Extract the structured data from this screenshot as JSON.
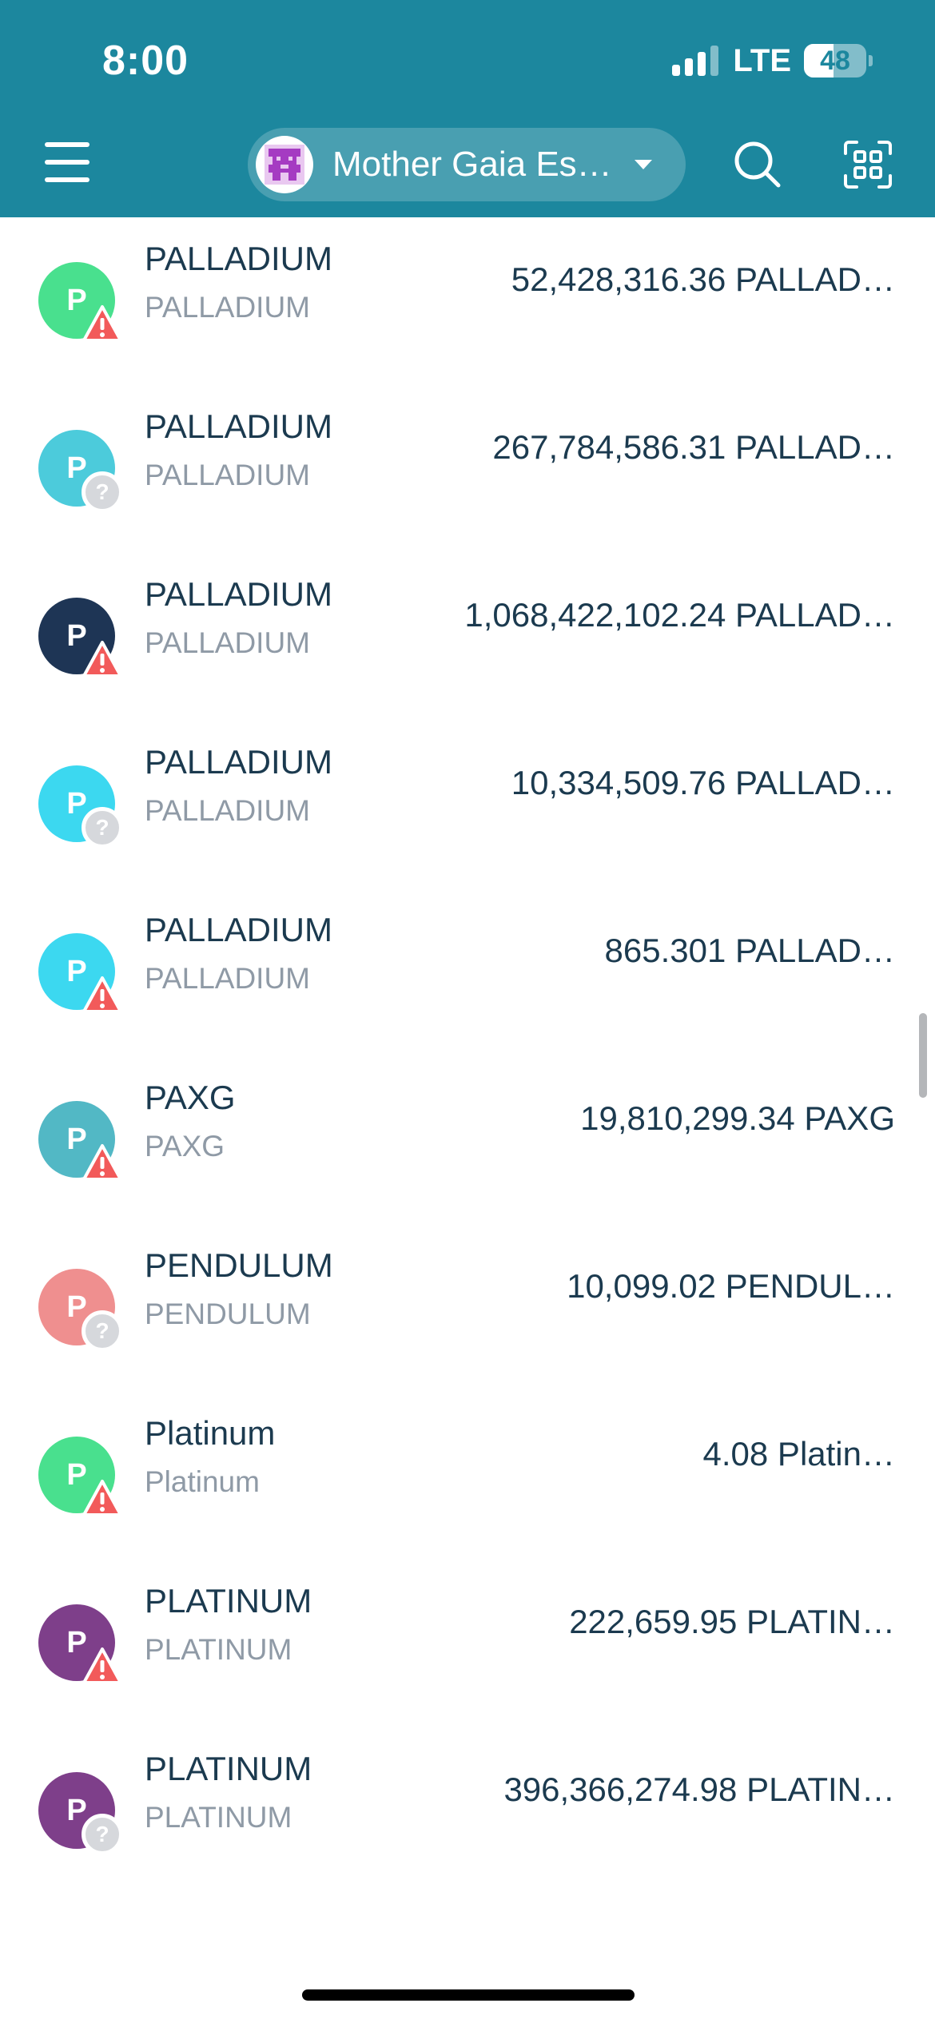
{
  "status_bar": {
    "time": "8:00",
    "network": "LTE",
    "battery": "48",
    "battery_level": 0.48
  },
  "header": {
    "menu_icon": "hamburger-menu-icon",
    "wallet_name": "Mother Gaia Es…",
    "search_icon": "search-icon",
    "scan_icon": "qr-scan-icon",
    "accent_color": "#1c879e"
  },
  "tokens": [
    {
      "letter": "P",
      "name": "PALLADIUM",
      "symbol": "PALLADIUM",
      "balance": "52,428,316.36 PALLAD…",
      "color": "#49e08e",
      "status": "warning"
    },
    {
      "letter": "P",
      "name": "PALLADIUM",
      "symbol": "PALLADIUM",
      "balance": "267,784,586.31 PALLAD…",
      "color": "#4ccbdb",
      "status": "unknown"
    },
    {
      "letter": "P",
      "name": "PALLADIUM",
      "symbol": "PALLADIUM",
      "balance": "1,068,422,102.24 PALLAD…",
      "color": "#1e3555",
      "status": "warning"
    },
    {
      "letter": "P",
      "name": "PALLADIUM",
      "symbol": "PALLADIUM",
      "balance": "10,334,509.76 PALLAD…",
      "color": "#3cd8f0",
      "status": "unknown"
    },
    {
      "letter": "P",
      "name": "PALLADIUM",
      "symbol": "PALLADIUM",
      "balance": "865.301 PALLAD…",
      "color": "#3cd8f0",
      "status": "warning"
    },
    {
      "letter": "P",
      "name": "PAXG",
      "symbol": "PAXG",
      "balance": "19,810,299.34 PAXG",
      "color": "#52b8c5",
      "status": "warning"
    },
    {
      "letter": "P",
      "name": "PENDULUM",
      "symbol": "PENDULUM",
      "balance": "10,099.02 PENDUL…",
      "color": "#ef8f8f",
      "status": "unknown"
    },
    {
      "letter": "P",
      "name": "Platinum",
      "symbol": "Platinum",
      "balance": "4.08 Platin…",
      "color": "#49e08e",
      "status": "warning"
    },
    {
      "letter": "P",
      "name": "PLATINUM",
      "symbol": "PLATINUM",
      "balance": "222,659.95 PLATIN…",
      "color": "#7e3f8a",
      "status": "warning"
    },
    {
      "letter": "P",
      "name": "PLATINUM",
      "symbol": "PLATINUM",
      "balance": "396,366,274.98 PLATIN…",
      "color": "#7e3f8a",
      "status": "unknown"
    }
  ],
  "badge_icons": {
    "warning": "warning-triangle-icon",
    "unknown": "unknown-question-icon"
  },
  "badge_colors": {
    "warning": "#f25a5a",
    "unknown": "#d6d8dc"
  }
}
